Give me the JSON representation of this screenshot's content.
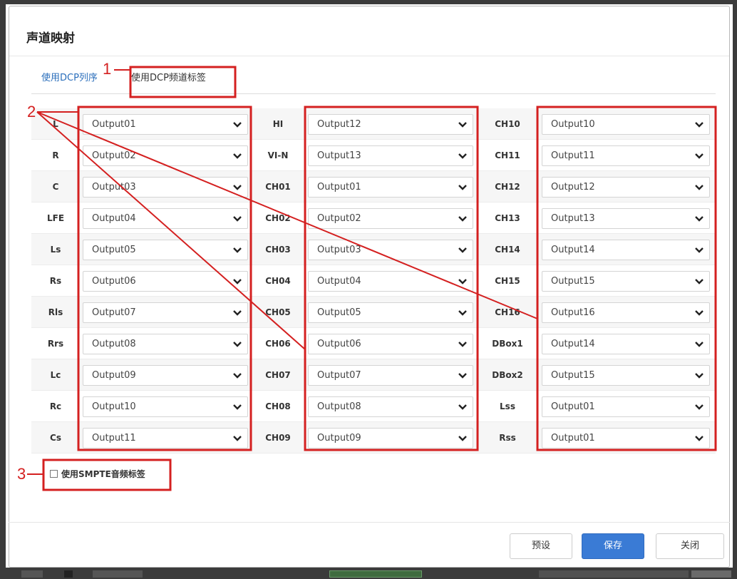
{
  "dialog": {
    "title": "声道映射",
    "tabs": [
      {
        "label": "使用DCP列序"
      },
      {
        "label": "使用DCP频道标签"
      }
    ],
    "columns": [
      {
        "rows": [
          {
            "label": "L",
            "value": "Output01"
          },
          {
            "label": "R",
            "value": "Output02"
          },
          {
            "label": "C",
            "value": "Output03"
          },
          {
            "label": "LFE",
            "value": "Output04"
          },
          {
            "label": "Ls",
            "value": "Output05"
          },
          {
            "label": "Rs",
            "value": "Output06"
          },
          {
            "label": "Rls",
            "value": "Output07"
          },
          {
            "label": "Rrs",
            "value": "Output08"
          },
          {
            "label": "Lc",
            "value": "Output09"
          },
          {
            "label": "Rc",
            "value": "Output10"
          },
          {
            "label": "Cs",
            "value": "Output11"
          }
        ]
      },
      {
        "rows": [
          {
            "label": "HI",
            "value": "Output12"
          },
          {
            "label": "VI-N",
            "value": "Output13"
          },
          {
            "label": "CH01",
            "value": "Output01"
          },
          {
            "label": "CH02",
            "value": "Output02"
          },
          {
            "label": "CH03",
            "value": "Output03"
          },
          {
            "label": "CH04",
            "value": "Output04"
          },
          {
            "label": "CH05",
            "value": "Output05"
          },
          {
            "label": "CH06",
            "value": "Output06"
          },
          {
            "label": "CH07",
            "value": "Output07"
          },
          {
            "label": "CH08",
            "value": "Output08"
          },
          {
            "label": "CH09",
            "value": "Output09"
          }
        ]
      },
      {
        "rows": [
          {
            "label": "CH10",
            "value": "Output10"
          },
          {
            "label": "CH11",
            "value": "Output11"
          },
          {
            "label": "CH12",
            "value": "Output12"
          },
          {
            "label": "CH13",
            "value": "Output13"
          },
          {
            "label": "CH14",
            "value": "Output14"
          },
          {
            "label": "CH15",
            "value": "Output15"
          },
          {
            "label": "CH16",
            "value": "Output16"
          },
          {
            "label": "DBox1",
            "value": "Output14"
          },
          {
            "label": "DBox2",
            "value": "Output15"
          },
          {
            "label": "Lss",
            "value": "Output01"
          },
          {
            "label": "Rss",
            "value": "Output01"
          }
        ]
      }
    ],
    "smpte_label": "使用SMPTE音频标签",
    "buttons": {
      "preset": "预设",
      "save": "保存",
      "close": "关闭"
    }
  },
  "annotations": {
    "marker_1": "1",
    "marker_2": "2",
    "marker_3": "3"
  },
  "colors": {
    "accent": "#3a7bd5",
    "annotation_red": "#d42020",
    "tab_link": "#2a6ebb"
  },
  "icons": {
    "select_arrow": "chevron-down-icon",
    "checkbox": "checkbox-unchecked-icon"
  }
}
